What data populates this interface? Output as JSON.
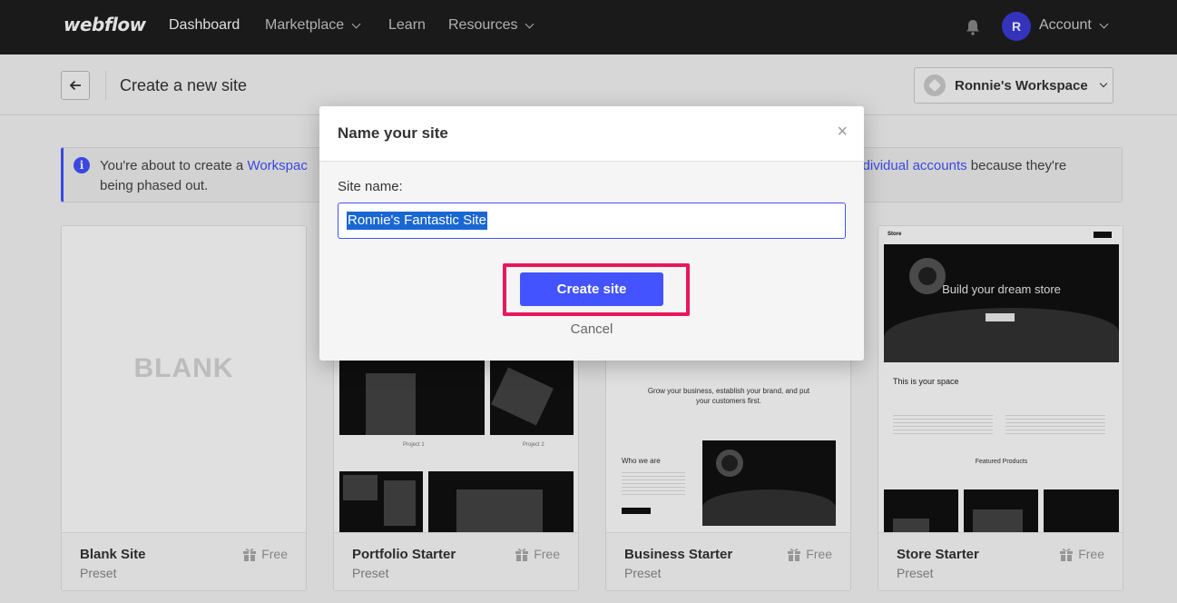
{
  "nav": {
    "logo": "webflow",
    "links": [
      "Dashboard",
      "Marketplace",
      "Learn",
      "Resources"
    ],
    "avatar_initial": "R",
    "account_label": "Account"
  },
  "subheader": {
    "title": "Create a new site",
    "workspace": "Ronnie's Workspace"
  },
  "banner": {
    "text_before": "You're about to create a ",
    "link1": "Workspac",
    "link2": "individual accounts",
    "text_after": " because they're",
    "line2": "being phased out."
  },
  "cards": [
    {
      "name": "Blank Site",
      "sub": "Preset",
      "price": "Free",
      "preview_text": "BLANK"
    },
    {
      "name": "Portfolio Starter",
      "sub": "Preset",
      "price": "Free"
    },
    {
      "name": "Business Starter",
      "sub": "Preset",
      "price": "Free",
      "headline": "Grow your business, establish your brand, and put your customers first.",
      "section": "Who we are"
    },
    {
      "name": "Store Starter",
      "sub": "Preset",
      "price": "Free",
      "brand": "Store",
      "hero": "Build your dream store",
      "space": "This is your space",
      "featured": "Featured Products"
    }
  ],
  "modal": {
    "title": "Name your site",
    "close": "×",
    "field_label": "Site name:",
    "input_value": "Ronnie's Fantastic Site",
    "create_label": "Create site",
    "cancel_label": "Cancel"
  },
  "colors": {
    "accent": "#4353ff",
    "highlight": "#e8175d",
    "nav_bg": "#1e1e1e"
  }
}
